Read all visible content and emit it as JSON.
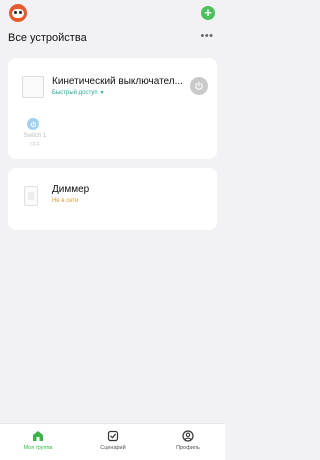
{
  "header": {
    "title": "Все устройства",
    "add_icon": "plus-icon",
    "more_icon": "more-dots-icon",
    "avatar_icon": "robot-avatar-icon"
  },
  "devices": [
    {
      "name": "Кинетический выключател...",
      "subtitle": "Быстрый доступ",
      "subtitle_icon": "caret-down-icon",
      "power_icon": "power-icon",
      "switches": [
        {
          "label": "Switch 1",
          "state": "OFF"
        }
      ]
    },
    {
      "name": "Диммер",
      "status": "Не в сети"
    }
  ],
  "nav": {
    "items": [
      {
        "label": "Моя группа",
        "icon": "home-icon",
        "active": true
      },
      {
        "label": "Сценарий",
        "icon": "check-square-icon",
        "active": false
      },
      {
        "label": "Профиль",
        "icon": "user-circle-icon",
        "active": false
      }
    ]
  },
  "colors": {
    "accent": "#39b54a",
    "quick_access": "#2aa79b",
    "offline": "#e59b2c",
    "avatar": "#e65a2e"
  }
}
